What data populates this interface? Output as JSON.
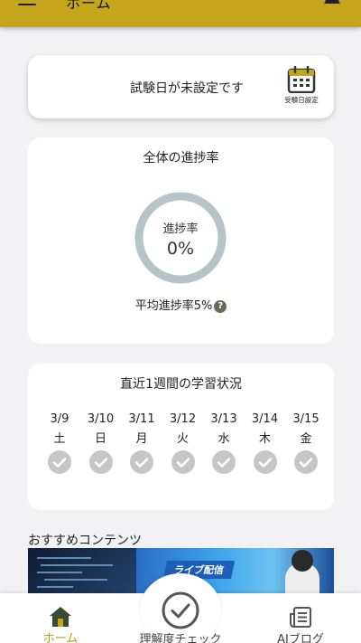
{
  "header": {
    "title": "ホーム"
  },
  "exam": {
    "message": "試験日が未設定です",
    "calendar_label": "受験日設定"
  },
  "progress": {
    "title": "全体の進捗率",
    "ring_label": "進捗率",
    "value_text": "0%",
    "value": 0,
    "average_text": "平均進捗率5%",
    "help_icon": "?"
  },
  "week": {
    "title": "直近1週間の学習状況",
    "days": [
      {
        "date": "3/9",
        "weekday": "土"
      },
      {
        "date": "3/10",
        "weekday": "日"
      },
      {
        "date": "3/11",
        "weekday": "月"
      },
      {
        "date": "3/12",
        "weekday": "火"
      },
      {
        "date": "3/13",
        "weekday": "水"
      },
      {
        "date": "3/14",
        "weekday": "木"
      },
      {
        "date": "3/15",
        "weekday": "金"
      }
    ]
  },
  "recommend": {
    "title": "おすすめコンテンツ",
    "banner_label": "ライブ配信"
  },
  "tabs": [
    {
      "label": "ホーム",
      "icon": "home-icon",
      "active": true
    },
    {
      "label": "理解度チェック",
      "icon": "check-circle-icon",
      "active": false
    },
    {
      "label": "AIブログ",
      "icon": "document-icon",
      "active": false
    }
  ],
  "colors": {
    "accent": "#c4a51c",
    "ring": "#b7c4c7",
    "check_inactive": "#c6c6c6"
  }
}
